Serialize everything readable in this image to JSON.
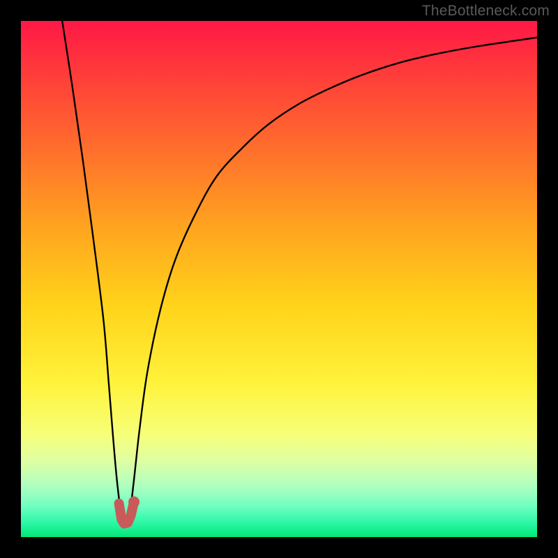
{
  "watermark": "TheBottleneck.com",
  "gradient": {
    "stops": [
      {
        "offset": 0.0,
        "color": "#ff1846"
      },
      {
        "offset": 0.1,
        "color": "#ff3b3a"
      },
      {
        "offset": 0.25,
        "color": "#ff6f2c"
      },
      {
        "offset": 0.4,
        "color": "#ffa41f"
      },
      {
        "offset": 0.55,
        "color": "#ffd31a"
      },
      {
        "offset": 0.7,
        "color": "#fff23a"
      },
      {
        "offset": 0.8,
        "color": "#f7ff78"
      },
      {
        "offset": 0.85,
        "color": "#e0ffa0"
      },
      {
        "offset": 0.9,
        "color": "#b0ffc0"
      },
      {
        "offset": 0.94,
        "color": "#70ffc0"
      },
      {
        "offset": 0.97,
        "color": "#30f8a8"
      },
      {
        "offset": 1.0,
        "color": "#00e878"
      }
    ]
  },
  "chart_data": {
    "type": "line",
    "title": "",
    "xlabel": "",
    "ylabel": "",
    "xlim": [
      0,
      100
    ],
    "ylim": [
      0,
      100
    ],
    "series": [
      {
        "name": "bottleneck-curve",
        "x": [
          8,
          10,
          12,
          14,
          16,
          17,
          17.8,
          18.5,
          19.2,
          19.8,
          20.3,
          20.8,
          21.3,
          22.0,
          23.0,
          24.5,
          27,
          30,
          34,
          38,
          43,
          48,
          54,
          60,
          66,
          73,
          80,
          88,
          96,
          100
        ],
        "y": [
          100,
          87,
          73,
          58,
          42,
          30,
          20,
          12,
          6,
          3.0,
          2.4,
          3.0,
          6,
          12,
          21,
          32,
          44,
          54,
          63,
          70,
          75.5,
          80,
          84,
          87,
          89.5,
          91.8,
          93.5,
          95,
          96.2,
          96.8
        ]
      }
    ],
    "marker": {
      "name": "highlight-segment",
      "color": "#c85a5a",
      "points_x": [
        19.0,
        19.5,
        20.0,
        20.7,
        21.3,
        21.9
      ],
      "points_y": [
        6.5,
        3.4,
        2.6,
        2.8,
        4.2,
        6.8
      ]
    }
  }
}
